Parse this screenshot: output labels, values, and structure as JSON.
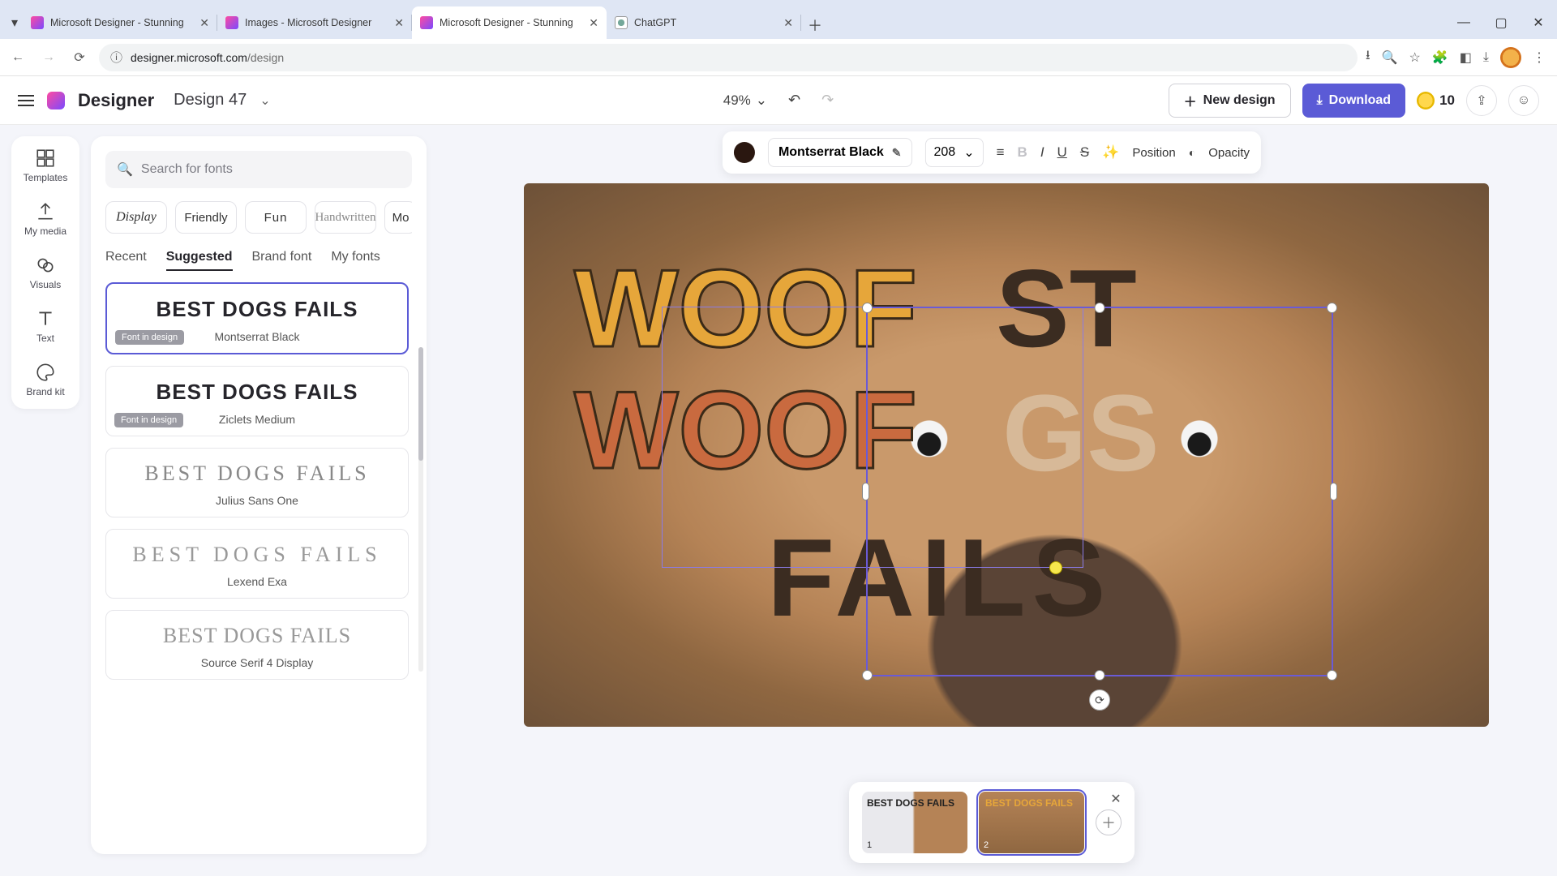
{
  "browser": {
    "tabs": [
      {
        "title": "Microsoft Designer - Stunning"
      },
      {
        "title": "Images - Microsoft Designer"
      },
      {
        "title": "Microsoft Designer - Stunning"
      },
      {
        "title": "ChatGPT"
      }
    ],
    "url_host": "designer.microsoft.com",
    "url_path": "/design"
  },
  "header": {
    "brand": "Designer",
    "doc_name": "Design 47",
    "zoom": "49%",
    "new_design": "New design",
    "download": "Download",
    "coins": "10"
  },
  "rail": {
    "templates": "Templates",
    "my_media": "My media",
    "visuals": "Visuals",
    "text": "Text",
    "brand_kit": "Brand kit"
  },
  "panel": {
    "search_placeholder": "Search for fonts",
    "chips": {
      "display": "Display",
      "friendly": "Friendly",
      "fun": "Fun",
      "handwritten": "Handwritten",
      "more": "Mo"
    },
    "tabs": {
      "recent": "Recent",
      "suggested": "Suggested",
      "brand": "Brand font",
      "my": "My fonts"
    },
    "badge": "Font in design",
    "cards": [
      {
        "sample": "BEST DOGS FAILS",
        "name": "Montserrat Black"
      },
      {
        "sample": "BEST DOGS FAILS",
        "name": "Ziclets Medium"
      },
      {
        "sample": "BEST DOGS FAILS",
        "name": "Julius Sans One"
      },
      {
        "sample": "BEST DOGS FAILS",
        "name": "Lexend Exa"
      },
      {
        "sample": "BEST DOGS FAILS",
        "name": "Source Serif 4 Display"
      }
    ]
  },
  "context": {
    "font_name": "Montserrat Black",
    "font_size": "208",
    "position": "Position",
    "opacity": "Opacity"
  },
  "canvas": {
    "line1a": "WOOF",
    "line1b": "ST",
    "line2a": "WOOF",
    "line2b": "GS",
    "line3": "FAILS"
  },
  "pages": {
    "p1_label": "BEST\nDOGS\nFAILS",
    "p1_num": "1",
    "p2_label": "BEST\nDOGS\nFAILS",
    "p2_num": "2"
  }
}
